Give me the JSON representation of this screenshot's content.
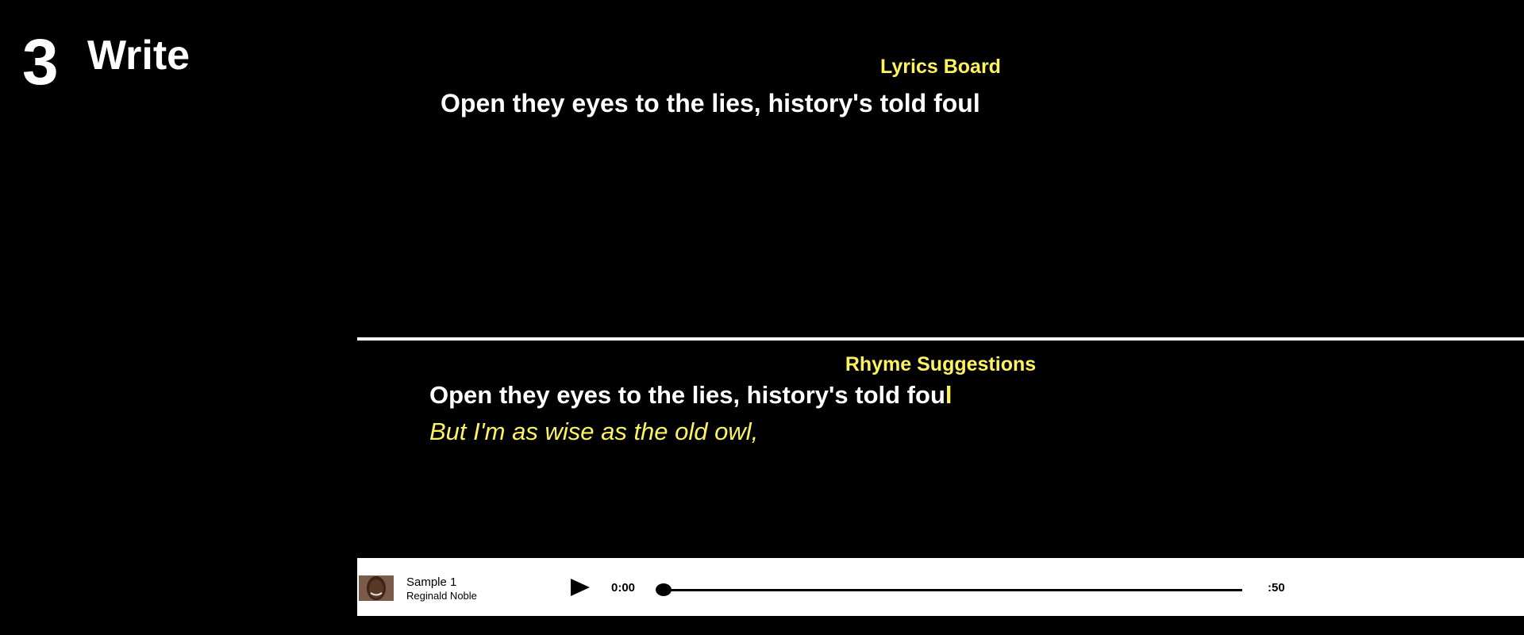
{
  "step": {
    "number": "3",
    "title": "Write"
  },
  "lyrics_board": {
    "heading": "Lyrics Board",
    "line": "Open they eyes to the lies, history's told foul"
  },
  "rhyme_suggestions": {
    "heading": "Rhyme Suggestions",
    "line_main": "Open they eyes to the lies, history's told fou",
    "line_highlight": "l",
    "suggestion": "But I'm as wise as the old owl,"
  },
  "player": {
    "track_title": "Sample 1",
    "artist": "Reginald Noble",
    "current_time": "0:00",
    "total_time": ":50",
    "progress": 0
  },
  "colors": {
    "accent": "#fdf361",
    "background": "#000000",
    "player_bg": "#ffffff"
  },
  "icons": {
    "play": "play-icon",
    "avatar": "artist-avatar"
  }
}
